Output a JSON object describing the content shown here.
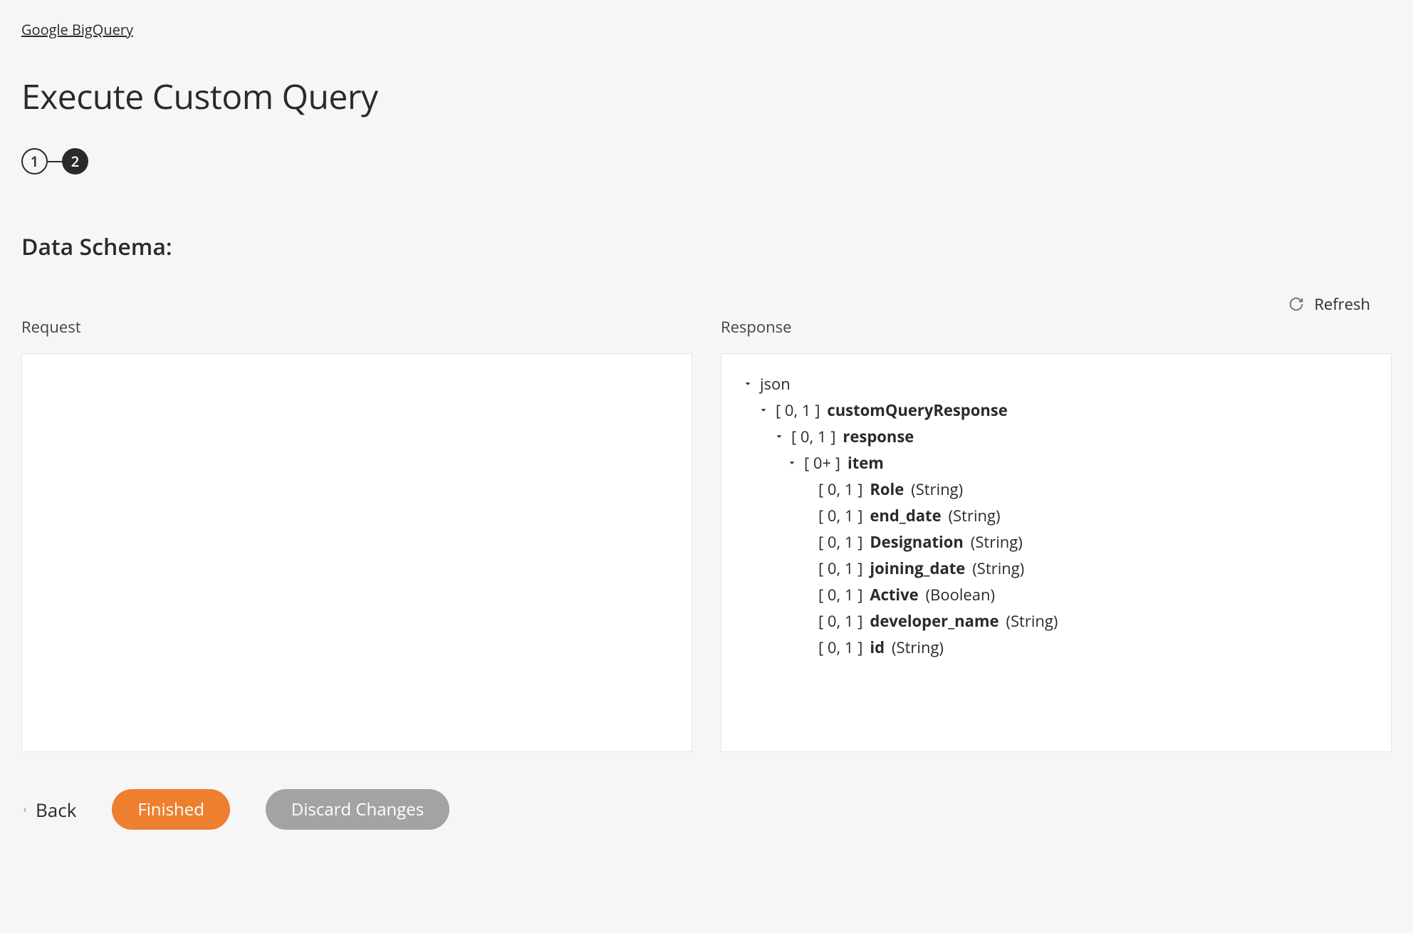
{
  "breadcrumb": {
    "label": "Google BigQuery"
  },
  "page_title": "Execute Custom Query",
  "stepper": {
    "step1": "1",
    "step2": "2"
  },
  "section_heading": "Data Schema:",
  "refresh_label": "Refresh",
  "panels": {
    "request_label": "Request",
    "response_label": "Response"
  },
  "tree": {
    "root": "json",
    "l1_card": "[ 0, 1 ]",
    "l1_name": "customQueryResponse",
    "l2_card": "[ 0, 1 ]",
    "l2_name": "response",
    "l3_card": "[ 0+ ]",
    "l3_name": "item",
    "fields": [
      {
        "card": "[ 0, 1 ]",
        "name": "Role",
        "type": "(String)"
      },
      {
        "card": "[ 0, 1 ]",
        "name": "end_date",
        "type": "(String)"
      },
      {
        "card": "[ 0, 1 ]",
        "name": "Designation",
        "type": "(String)"
      },
      {
        "card": "[ 0, 1 ]",
        "name": "joining_date",
        "type": "(String)"
      },
      {
        "card": "[ 0, 1 ]",
        "name": "Active",
        "type": "(Boolean)"
      },
      {
        "card": "[ 0, 1 ]",
        "name": "developer_name",
        "type": "(String)"
      },
      {
        "card": "[ 0, 1 ]",
        "name": "id",
        "type": "(String)"
      }
    ]
  },
  "footer": {
    "back": "Back",
    "finished": "Finished",
    "discard": "Discard Changes"
  }
}
